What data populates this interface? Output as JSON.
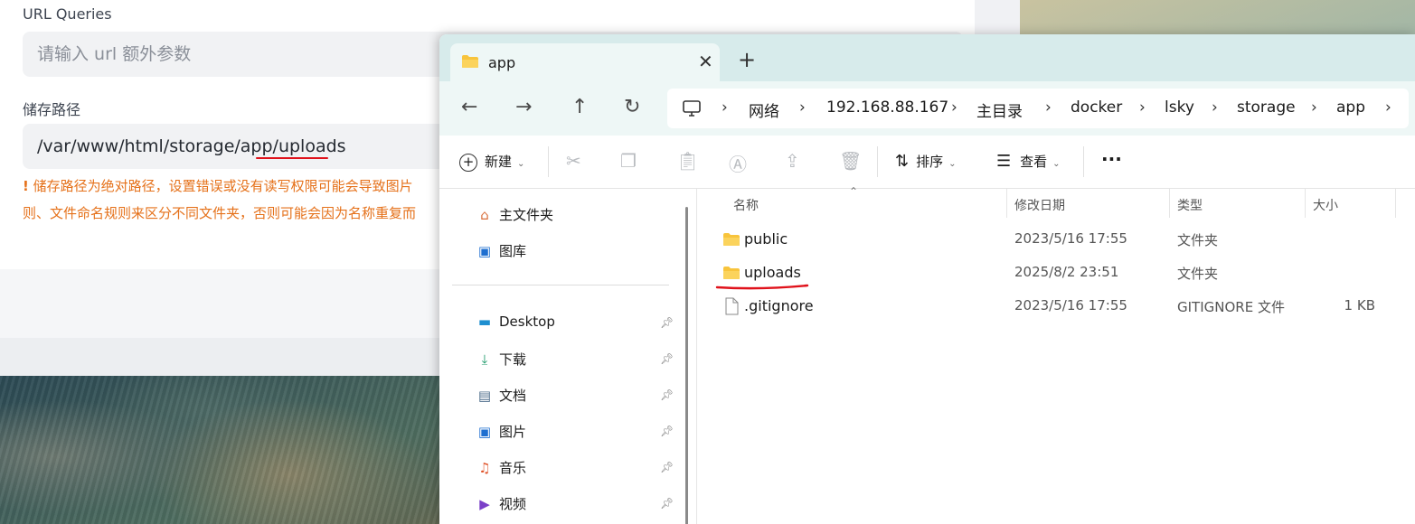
{
  "web_form": {
    "url_queries_label": "URL Queries",
    "url_queries_placeholder": "请输入 url 额外参数",
    "storage_path_label": "储存路径",
    "storage_path_value": "/var/www/html/storage/app/uploads",
    "warning_line1": "储存路径为绝对路径，设置错误或没有读写权限可能会导致图片",
    "warning_line2": "则、文件命名规则来区分不同文件夹，否则可能会因为名称重复而"
  },
  "explorer": {
    "tab_title": "app",
    "tab_close": "✕",
    "tab_add": "+",
    "nav": {
      "back": "←",
      "forward": "→",
      "up": "↑",
      "refresh": "↻"
    },
    "breadcrumbs": [
      "网络",
      "192.168.88.167",
      "主目录",
      "docker",
      "lsky",
      "storage",
      "app"
    ],
    "toolbar": {
      "new_label": "新建",
      "sort_label": "排序",
      "view_label": "查看",
      "more": "···"
    },
    "nav_pane": {
      "top_items": [
        {
          "label": "主文件夹",
          "icon": "home-icon"
        },
        {
          "label": "图库",
          "icon": "gallery-icon"
        }
      ],
      "pinned_items": [
        {
          "label": "Desktop",
          "icon": "desktop-icon"
        },
        {
          "label": "下载",
          "icon": "download-icon"
        },
        {
          "label": "文档",
          "icon": "document-icon"
        },
        {
          "label": "图片",
          "icon": "pictures-icon"
        },
        {
          "label": "音乐",
          "icon": "music-icon"
        },
        {
          "label": "视频",
          "icon": "video-icon"
        }
      ]
    },
    "columns": [
      "名称",
      "修改日期",
      "类型",
      "大小"
    ],
    "files": [
      {
        "name": "public",
        "date": "2023/5/16 17:55",
        "type": "文件夹",
        "size": "",
        "icon": "folder-icon"
      },
      {
        "name": "uploads",
        "date": "2025/8/2 23:51",
        "type": "文件夹",
        "size": "",
        "icon": "folder-icon"
      },
      {
        "name": ".gitignore",
        "date": "2023/5/16 17:55",
        "type": "GITIGNORE 文件",
        "size": "1 KB",
        "icon": "file-icon"
      }
    ]
  },
  "colors": {
    "accent_red": "#e0121b",
    "warning_orange": "#e5711a",
    "folder_yellow": "#f8c43c",
    "tab_bg": "#d7ebeb"
  }
}
